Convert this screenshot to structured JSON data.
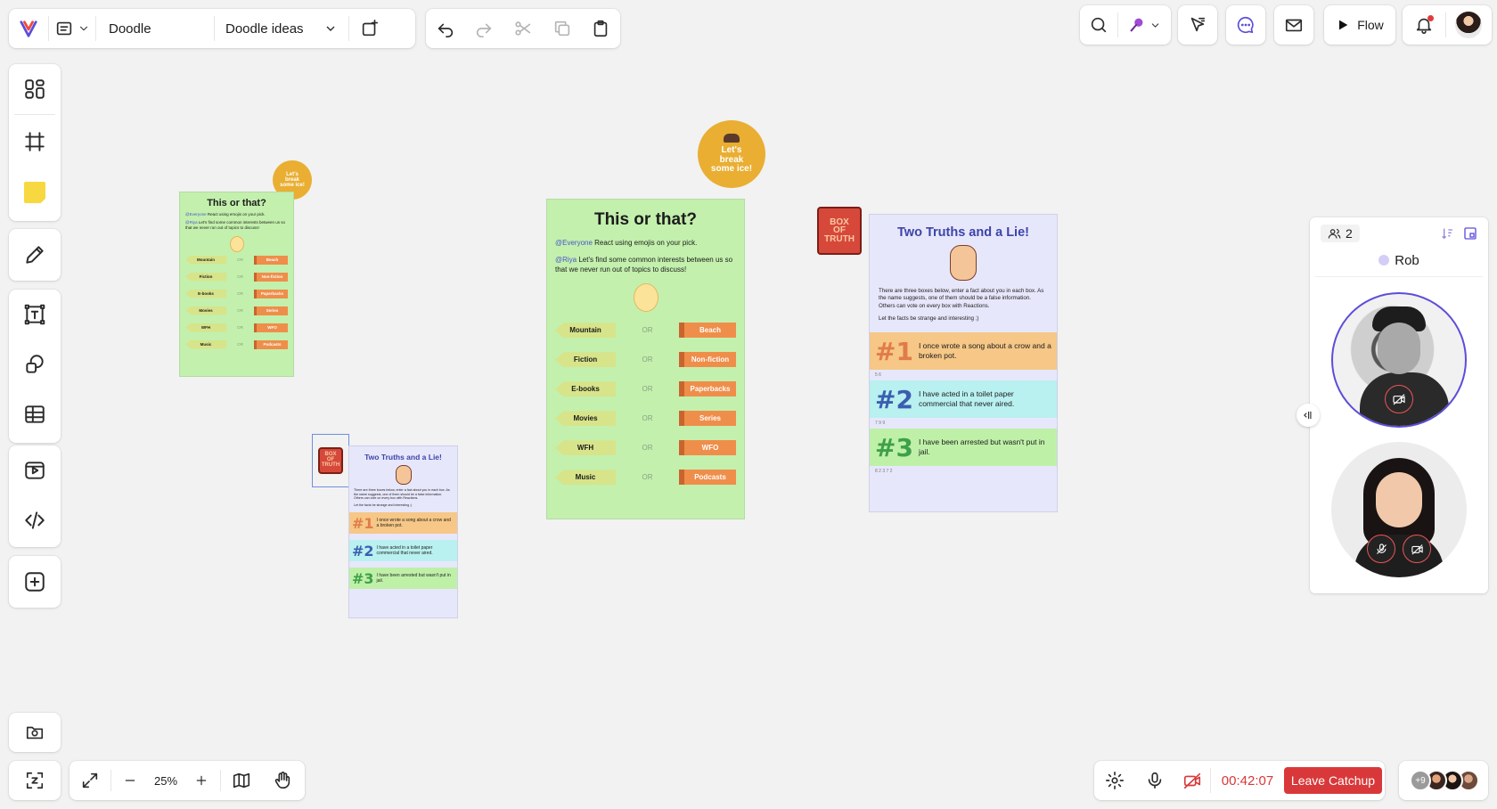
{
  "topbar": {
    "board_name": "Doodle",
    "board_select": "Doodle ideas"
  },
  "right_toolbar": {
    "flow_label": "Flow"
  },
  "zoom": {
    "level": "25%"
  },
  "call": {
    "timer": "00:42:07",
    "leave_label": "Leave Catchup",
    "extra_participants": "+9",
    "participants_count": "2",
    "participant_name": "Rob"
  },
  "board_small_this_or_that": {
    "title": "This or that?",
    "line1_mention": "@Everyone",
    "line1_text": " React using emojis on your pick.",
    "line2_mention": "@Riya",
    "line2_text": " Let's find some common interests between us so that we never run out of topics to discuss!",
    "rows": [
      {
        "left": "Mountain",
        "right": "Beach"
      },
      {
        "left": "Fiction",
        "right": "Non-fiction"
      },
      {
        "left": "E-books",
        "right": "Paperbacks"
      },
      {
        "left": "Movies",
        "right": "Series"
      },
      {
        "left": "WFH",
        "right": "WFO"
      },
      {
        "left": "Music",
        "right": "Podcasts"
      }
    ],
    "or": "OR"
  },
  "board_large_this_or_that": {
    "title": "This or that?",
    "line1_mention": "@Everyone",
    "line1_text": " React using emojis on your pick.",
    "line2_mention": "@Riya",
    "line2_text": " Let's find some common interests between us so that we never run out of topics to discuss!",
    "rows": [
      {
        "left": "Mountain",
        "right": "Beach"
      },
      {
        "left": "Fiction",
        "right": "Non-fiction"
      },
      {
        "left": "E-books",
        "right": "Paperbacks"
      },
      {
        "left": "Movies",
        "right": "Series"
      },
      {
        "left": "WFH",
        "right": "WFO"
      },
      {
        "left": "Music",
        "right": "Podcasts"
      }
    ],
    "or": "OR"
  },
  "badge": {
    "line1": "Let's",
    "line2": "break",
    "line3": "some ice!"
  },
  "book": {
    "line1": "BOX",
    "line2": "OF",
    "line3": "TRUTH"
  },
  "truths_large": {
    "title": "Two Truths and a Lie!",
    "intro": "There are three boxes below, enter a fact about you in each box. As the name suggests, one of them should be a false information. Others can vote on every box with Reactions.",
    "note": "Let the facts be strange and interesting ;)",
    "items": [
      {
        "num": "#1",
        "text": "I once wrote a song about a crow and a broken pot.",
        "votes": "5   6"
      },
      {
        "num": "#2",
        "text": "I have acted in a toilet paper commercial that never aired.",
        "votes": "7   9   9"
      },
      {
        "num": "#3",
        "text": "I have been arrested but wasn't put in jail.",
        "votes": "8   2   3   7   2"
      }
    ]
  },
  "truths_small": {
    "title": "Two Truths and a Lie!",
    "intro": "There are three boxes below, enter a fact about you in each box. As the name suggests, one of them should be a false information. Others can vote on every box with Reactions.",
    "note": "Let the facts be strange and interesting ;)",
    "items": [
      {
        "num": "#1",
        "text": "I once wrote a song about a crow and a broken pot."
      },
      {
        "num": "#2",
        "text": "I have acted in a toilet paper commercial that never aired."
      },
      {
        "num": "#3",
        "text": "I have been arrested but wasn't put in jail."
      }
    ]
  },
  "colors": {
    "accent": "#5b4ddb",
    "leave_red": "#d9383a",
    "timer_red": "#d9383a",
    "green_card": "#c3f0ad",
    "lavender_card": "#e7e7fb",
    "sticky_yellow": "#f7d840"
  },
  "icons": [
    "logo-icon",
    "file-icon",
    "chevron-down-icon",
    "add-page-icon",
    "undo-icon",
    "redo-icon",
    "cut-icon",
    "copy-icon",
    "paste-icon",
    "search-icon",
    "pin-icon",
    "pointer-icon",
    "chat-icon",
    "mail-icon",
    "play-icon",
    "bell-icon",
    "templates-icon",
    "frame-icon",
    "sticky-note-icon",
    "pen-icon",
    "text-icon",
    "shapes-icon",
    "table-icon",
    "video-icon",
    "code-icon",
    "plus-square-icon",
    "folder-screen-icon",
    "fit-icon",
    "expand-icon",
    "minus-icon",
    "plus-icon",
    "map-icon",
    "hand-icon",
    "settings-icon",
    "mic-icon",
    "camera-off-icon",
    "users-icon",
    "sort-icon",
    "layout-icon",
    "collapse-icon",
    "mic-off-icon"
  ]
}
